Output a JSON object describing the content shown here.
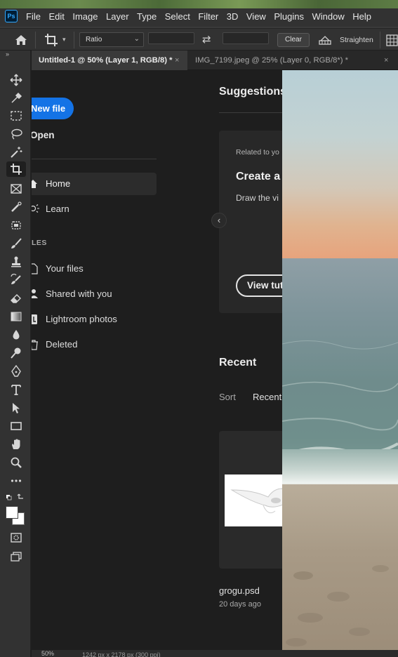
{
  "app": {
    "logo": "Ps"
  },
  "menu": [
    "File",
    "Edit",
    "Image",
    "Layer",
    "Type",
    "Select",
    "Filter",
    "3D",
    "View",
    "Plugins",
    "Window",
    "Help"
  ],
  "options_bar": {
    "ratio_value": "Ratio",
    "clear_label": "Clear",
    "straighten_label": "Straighten"
  },
  "tabs": [
    {
      "label": "Untitled-1 @ 50% (Layer 1, RGB/8) *",
      "close": "×"
    },
    {
      "label": "IMG_7199.jpeg @ 25% (Layer 0, RGB/8*) *",
      "close": "×"
    }
  ],
  "home": {
    "new_file": "New file",
    "open": "Open",
    "nav": [
      {
        "label": "Home",
        "icon": "home-icon"
      },
      {
        "label": "Learn",
        "icon": "bulb-icon"
      }
    ],
    "files_section": "LES",
    "files": [
      {
        "label": "Your files",
        "icon": "file-icon"
      },
      {
        "label": "Shared with you",
        "icon": "people-icon"
      },
      {
        "label": "Lightroom photos",
        "icon": "lightroom-icon"
      },
      {
        "label": "Deleted",
        "icon": "trash-icon"
      }
    ],
    "collapse": "‹",
    "suggestions_title": "Suggestions",
    "card": {
      "related": "Related to yo",
      "title": "Create a",
      "desc": "Draw the vi",
      "button": "View tut"
    },
    "recent_title": "Recent",
    "sort_label": "Sort",
    "sort_value": "Recent",
    "recent_file": {
      "name": "grogu.psd",
      "date": "20 days ago"
    }
  },
  "status": {
    "zoom": "50%",
    "dims": "1242 px x 2178 px (300 ppi)"
  }
}
